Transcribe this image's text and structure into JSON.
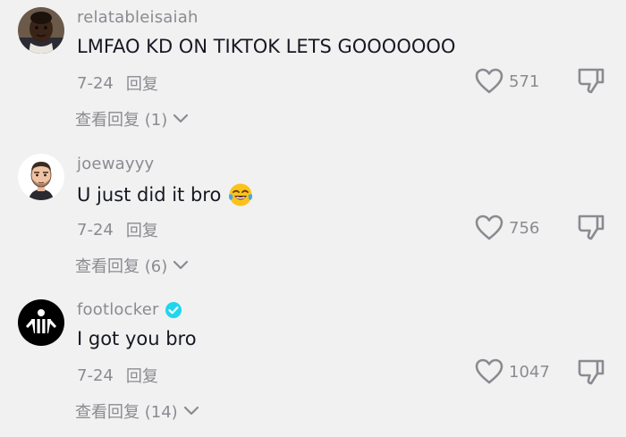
{
  "comments": [
    {
      "username": "relatableisaiah",
      "verified": false,
      "text": "LMFAO KD ON TIKTOK LETS GOOOOOOO",
      "emoji": "",
      "date": "7-24",
      "reply_label": "回复",
      "like_count": "571",
      "view_replies_label": "查看回复 (1)",
      "avatar_icon": "child-portrait-avatar"
    },
    {
      "username": "joewayyy",
      "verified": false,
      "text": "U just did it bro",
      "emoji": "tears-of-joy-emoji",
      "date": "7-24",
      "reply_label": "回复",
      "like_count": "756",
      "view_replies_label": "查看回复 (6)",
      "avatar_icon": "cartoon-man-avatar"
    },
    {
      "username": "footlocker",
      "verified": true,
      "text": "I got you bro",
      "emoji": "",
      "date": "7-24",
      "reply_label": "回复",
      "like_count": "1047",
      "view_replies_label": "查看回复 (14)",
      "avatar_icon": "referee-logo-avatar"
    }
  ],
  "colors": {
    "background": "#f1f1f1",
    "primary_text": "#161823",
    "secondary_text": "#8a8b91",
    "verified_badge": "#20d5ec",
    "icon_gray": "#8a8b91"
  }
}
